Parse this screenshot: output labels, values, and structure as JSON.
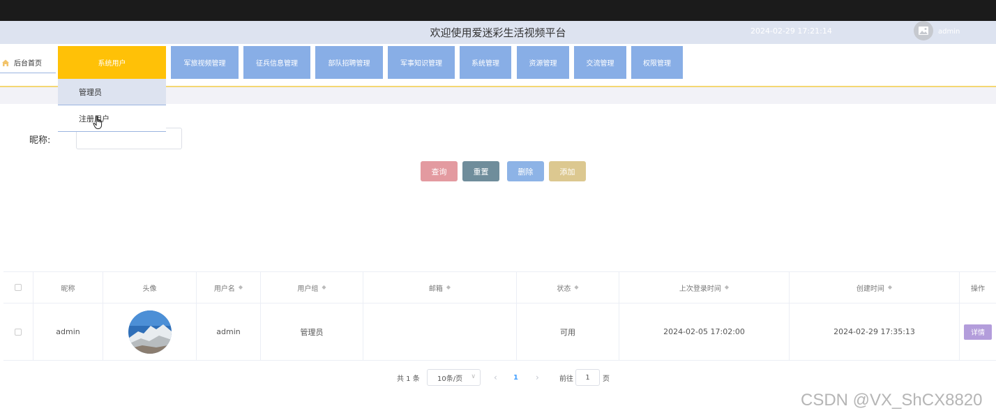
{
  "header": {
    "title": "欢迎使用爱迷彩生活视频平台",
    "datetime": "2024-02-29 17:21:14",
    "username": "admin"
  },
  "nav": {
    "home_label": "后台首页",
    "items": [
      {
        "label": "系统用户",
        "active": true
      },
      {
        "label": "军旅视频管理"
      },
      {
        "label": "征兵信息管理"
      },
      {
        "label": "部队招聘管理"
      },
      {
        "label": "军事知识管理"
      },
      {
        "label": "系统管理"
      },
      {
        "label": "资源管理"
      },
      {
        "label": "交流管理"
      },
      {
        "label": "权限管理"
      }
    ],
    "dropdown": [
      "管理员",
      "注册用户"
    ]
  },
  "search": {
    "label": "昵称:",
    "value": ""
  },
  "buttons": {
    "query": "查询",
    "reset": "重置",
    "delete": "删除",
    "add": "添加"
  },
  "colors": {
    "query": "#e39aa0",
    "reset": "#6f8d9b",
    "delete": "#8db3e6",
    "add": "#dcc890",
    "nav": "#88aee6",
    "nav_active": "#ffc107"
  },
  "table": {
    "headers": [
      "昵称",
      "头像",
      "用户名",
      "用户组",
      "邮箱",
      "状态",
      "上次登录时间",
      "创建时间",
      "操作"
    ],
    "sortable": [
      false,
      false,
      true,
      true,
      true,
      true,
      true,
      true,
      false
    ],
    "rows": [
      {
        "nickname": "admin",
        "username": "admin",
        "group": "管理员",
        "email": "",
        "status": "可用",
        "last_login": "2024-02-05 17:02:00",
        "created": "2024-02-29 17:35:13",
        "action": "详情"
      }
    ]
  },
  "pagination": {
    "total": "共 1 条",
    "page_size": "10条/页",
    "current": "1",
    "goto_label": "前往",
    "goto_value": "1",
    "page_unit": "页"
  },
  "watermark": "CSDN @VX_ShCX8820"
}
